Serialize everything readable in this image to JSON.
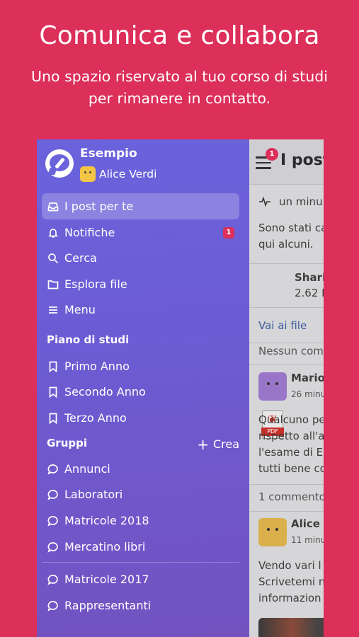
{
  "promo": {
    "title": "Comunica e collabora",
    "subtitle_line1": "Uno spazio riservato al tuo corso di studi",
    "subtitle_line2": "per rimanere in contatto."
  },
  "drawer": {
    "app_name": "Esempio",
    "user_name": "Alice Verdi",
    "main_nav": [
      {
        "label": "I post per te",
        "icon": "inbox-icon",
        "active": true
      },
      {
        "label": "Notifiche",
        "icon": "bell-icon",
        "badge": "1"
      },
      {
        "label": "Cerca",
        "icon": "search-icon"
      },
      {
        "label": "Esplora file",
        "icon": "folder-icon"
      },
      {
        "label": "Menu",
        "icon": "menu-icon"
      }
    ],
    "study_plan": {
      "title": "Piano di studi",
      "items": [
        "Primo Anno",
        "Secondo Anno",
        "Terzo Anno"
      ]
    },
    "groups": {
      "title": "Gruppi",
      "create_label": "Crea",
      "items": [
        "Annunci",
        "Laboratori",
        "Matricole 2018",
        "Mercatino libri"
      ],
      "more_items": [
        "Matricole 2017",
        "Rappresentanti"
      ]
    }
  },
  "feed": {
    "badge": "1",
    "title": "I post",
    "activity": "un minu",
    "intro_line1": "Sono stati ca",
    "intro_line2": "qui alcuni.",
    "file_name": "Shari",
    "file_size": "2.62 M",
    "file_type": "PDF",
    "files_link": "Vai ai file",
    "no_comments": "Nessun com",
    "post1_author": "Mario",
    "post1_time": "26 minu",
    "post1_lines": [
      "Qualcuno pe",
      "rispetto all'a",
      "l'esame di E",
      "tutti bene co"
    ],
    "post1_comments": "1 commento",
    "post2_author": "Alice",
    "post2_time": "11 minu",
    "post2_lines": [
      "Vendo vari l",
      "Scrivetemi n",
      "informazion"
    ]
  },
  "colors": {
    "background": "#dc2f59",
    "drawer_top": "#6a63dc",
    "drawer_bottom": "#7352c0",
    "badge": "#dc2f59"
  }
}
